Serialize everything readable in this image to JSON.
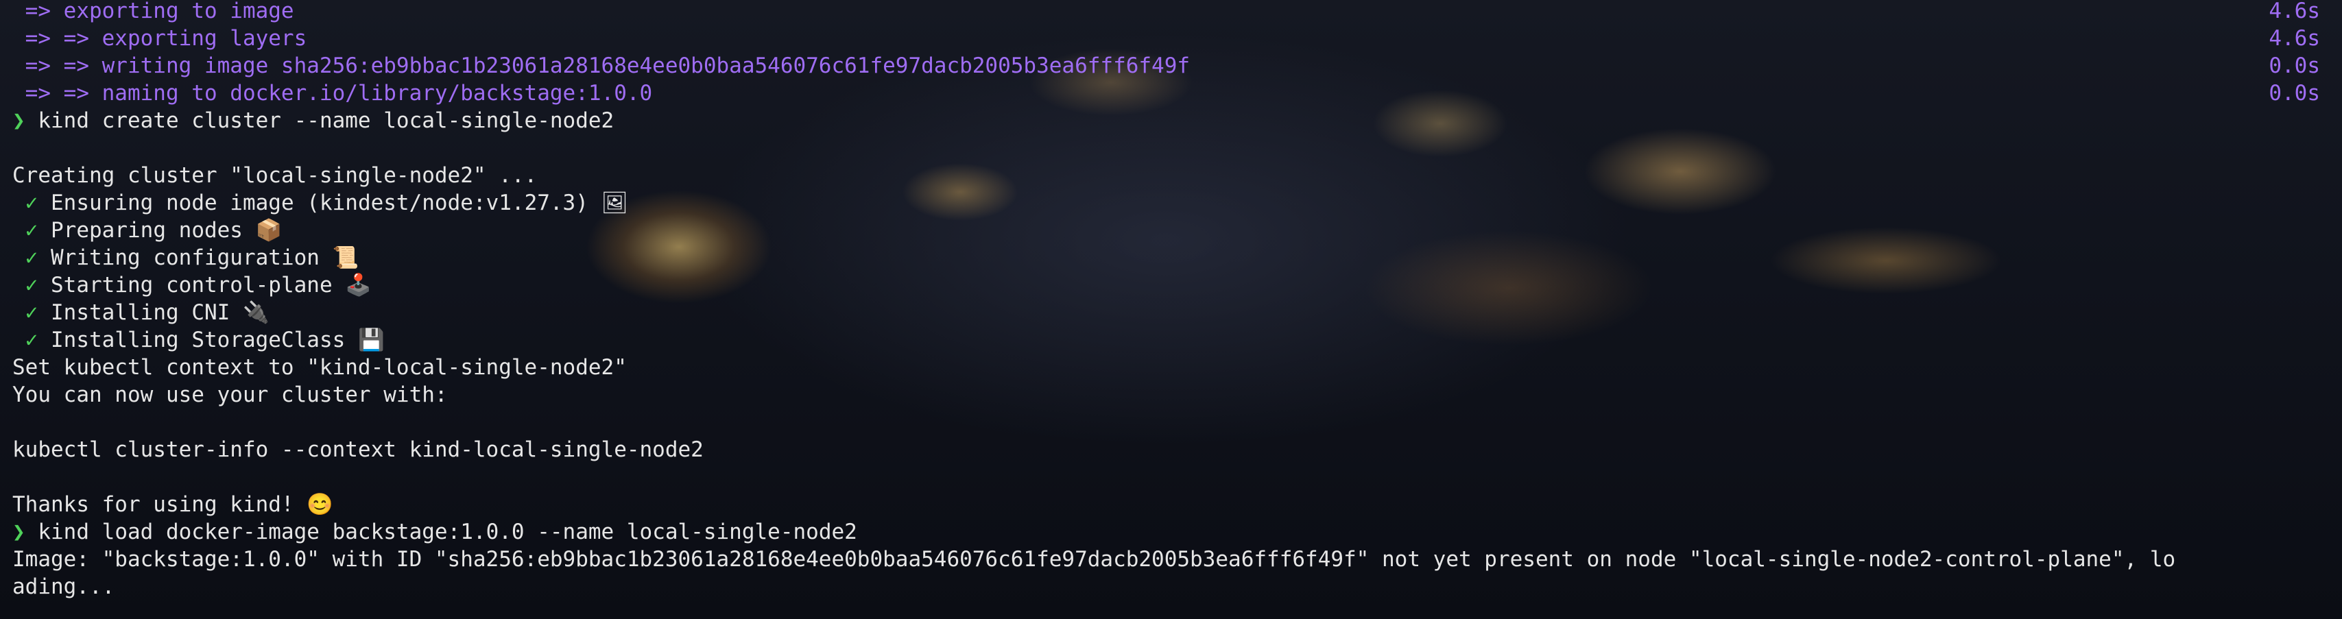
{
  "terminal": {
    "build_lines": [
      {
        "text": " => exporting to image",
        "time": "4.6s"
      },
      {
        "text": " => => exporting layers",
        "time": "4.6s"
      },
      {
        "text": " => => writing image sha256:eb9bbac1b23061a28168e4ee0b0baa546076c61fe97dacb2005b3ea6fff6f49f",
        "time": "0.0s"
      },
      {
        "text": " => => naming to docker.io/library/backstage:1.0.0",
        "time": "0.0s"
      }
    ],
    "prompt_symbol": "❯",
    "command1": "kind create cluster --name local-single-node2",
    "creating": "Creating cluster \"local-single-node2\" ...",
    "steps": [
      {
        "check": "✓",
        "text": "Ensuring node image (kindest/node:v1.27.3) 🖼"
      },
      {
        "check": "✓",
        "text": "Preparing nodes 📦"
      },
      {
        "check": "✓",
        "text": "Writing configuration 📜"
      },
      {
        "check": "✓",
        "text": "Starting control-plane 🕹️"
      },
      {
        "check": "✓",
        "text": "Installing CNI 🔌"
      },
      {
        "check": "✓",
        "text": "Installing StorageClass 💾"
      }
    ],
    "context_line": "Set kubectl context to \"kind-local-single-node2\"",
    "use_line": "You can now use your cluster with:",
    "info_cmd": "kubectl cluster-info --context kind-local-single-node2",
    "thanks": "Thanks for using kind! 😊",
    "command2": "kind load docker-image backstage:1.0.0 --name local-single-node2",
    "image_line1": "Image: \"backstage:1.0.0\" with ID \"sha256:eb9bbac1b23061a28168e4ee0b0baa546076c61fe97dacb2005b3ea6fff6f49f\" not yet present on node \"local-single-node2-control-plane\", lo",
    "image_line2": "ading..."
  },
  "colors": {
    "build_purple": "#9f6df3",
    "prompt_green": "#4fd15a",
    "text": "#e6e6e6"
  }
}
